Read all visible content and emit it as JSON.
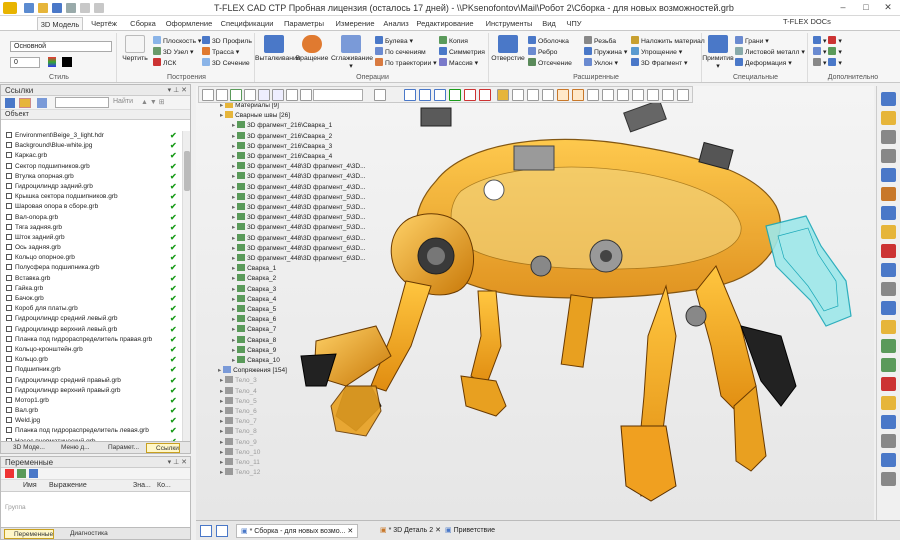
{
  "app": {
    "title": "T-FLEX CAD СТР Пробная лицензия (осталось 17 дней) - \\\\PKsenofontov\\Mail\\Робот 2\\Сборка - для новых возможностей.grb",
    "docs_label": "T-FLEX DOCs"
  },
  "tabs": [
    "3D Модель",
    "Чертёж",
    "Сборка",
    "Оформление",
    "Спецификации",
    "Параметры",
    "Измерение",
    "Анализ",
    "Редактирование",
    "Инструменты",
    "Вид",
    "ЧПУ"
  ],
  "ribbon": {
    "style": {
      "label": "Стиль",
      "layer": "Основной",
      "width": "0"
    },
    "build": {
      "label": "Построения",
      "draw": "Чертить",
      "items": [
        "Плоскость",
        "3D Узел",
        "ЛСК",
        "3D Профиль",
        "Трасса",
        "3D Сечение"
      ]
    },
    "ops": {
      "label": "Операции",
      "big": [
        "Выталкивание",
        "Вращение",
        "Сглаживание"
      ],
      "items": [
        "Булева",
        "По сечениям",
        "По траектории",
        "Копия",
        "Симметрия",
        "Массив"
      ]
    },
    "ext": {
      "label": "Расширенные",
      "big": "Отверстие",
      "items": [
        "Оболочка",
        "Ребро",
        "Отсечение",
        "Резьба",
        "Пружина",
        "Уклон",
        "Наложить материал",
        "Упрощение",
        "3D Фрагмент"
      ]
    },
    "spec": {
      "label": "Специальные",
      "big": "Примитив",
      "items": [
        "Грани",
        "Листовой металл",
        "Деформация"
      ]
    },
    "extra": {
      "label": "Дополнительно"
    }
  },
  "links_panel": {
    "title": "Ссылки",
    "find_label": "Найти",
    "column": "Объект",
    "files": [
      "Environment\\Beige_3_light.hdr",
      "Background\\Blue-white.jpg",
      "Каркас.grb",
      "Сектор подшипников.grb",
      "Втулка опорная.grb",
      "Гидроцилиндр задний.grb",
      "Крышка сектора подшипников.grb",
      "Шаровая опора в сборе.grb",
      "Вал-опора.grb",
      "Тяга задняя.grb",
      "Шток задний.grb",
      "Ось задняя.grb",
      "Кольцо опорное.grb",
      "Полусфера подшипника.grb",
      "Вставка.grb",
      "Гайка.grb",
      "Бачок.grb",
      "Короб для платы.grb",
      "Гидроцилиндр средний левый.grb",
      "Гидроцилиндр верхний левый.grb",
      "Планка под гидрораспределитель правая.grb",
      "Кольцо-кронштейн.grb",
      "Кольцо.grb",
      "Подшипник.grb",
      "Гидроцилиндр средний правый.grb",
      "Гидроцилиндр верхний правый.grb",
      "Мотор1.grb",
      "Вал.grb",
      "Weld.jpg",
      "Планка под гидрораспределитель левая.grb",
      "Насос пневматический.grb"
    ],
    "bottom_tabs": [
      "3D Моде...",
      "Меню д...",
      "Парамет...",
      "Ссылки"
    ]
  },
  "vars_panel": {
    "title": "Переменные",
    "columns": [
      "Имя",
      "Выражение",
      "Зна...",
      "Ко..."
    ],
    "group": "Группа",
    "bottom_tabs": [
      "Переменные",
      "Диагностика"
    ]
  },
  "tree": {
    "materials": "Материалы [9]",
    "welds": "Сварные швы [26]",
    "fragments": [
      "3D фрагмент_216\\Сварка_1",
      "3D фрагмент_216\\Сварка_2",
      "3D фрагмент_216\\Сварка_3",
      "3D фрагмент_216\\Сварка_4",
      "3D фрагмент_448\\3D фрагмент_4\\3D...",
      "3D фрагмент_448\\3D фрагмент_4\\3D...",
      "3D фрагмент_448\\3D фрагмент_4\\3D...",
      "3D фрагмент_448\\3D фрагмент_5\\3D...",
      "3D фрагмент_448\\3D фрагмент_5\\3D...",
      "3D фрагмент_448\\3D фрагмент_5\\3D...",
      "3D фрагмент_448\\3D фрагмент_5\\3D...",
      "3D фрагмент_448\\3D фрагмент_6\\3D...",
      "3D фрагмент_448\\3D фрагмент_6\\3D...",
      "3D фрагмент_448\\3D фрагмент_6\\3D..."
    ],
    "welds_list": [
      "Сварка_1",
      "Сварка_2",
      "Сварка_3",
      "Сварка_4",
      "Сварка_5",
      "Сварка_6",
      "Сварка_7",
      "Сварка_8",
      "Сварка_9",
      "Сварка_10"
    ],
    "mates": "Сопряжения [154]",
    "bodies": [
      "Тело_3",
      "Тело_4",
      "Тело_5",
      "Тело_6",
      "Тело_7",
      "Тело_8",
      "Тело_9",
      "Тело_10",
      "Тело_11",
      "Тело_12"
    ]
  },
  "doc_tabs": [
    "* Сборка - для новых возмо...",
    "* 3D Деталь 2",
    "Приветствие"
  ]
}
